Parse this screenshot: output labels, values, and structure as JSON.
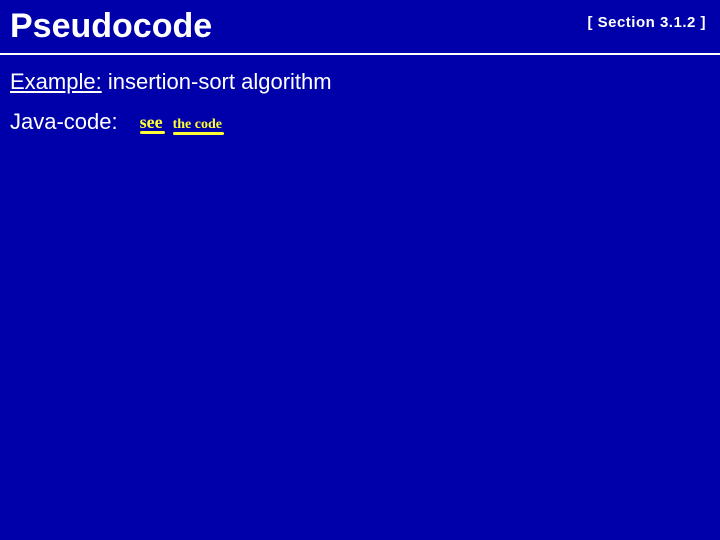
{
  "header": {
    "title": "Pseudocode",
    "section_ref": "[ Section 3.1.2 ]"
  },
  "content": {
    "example_label": "Example:",
    "example_text": " insertion-sort algorithm",
    "java_label": "Java-code:",
    "handwritten_1": "see",
    "handwritten_2": "the code"
  }
}
